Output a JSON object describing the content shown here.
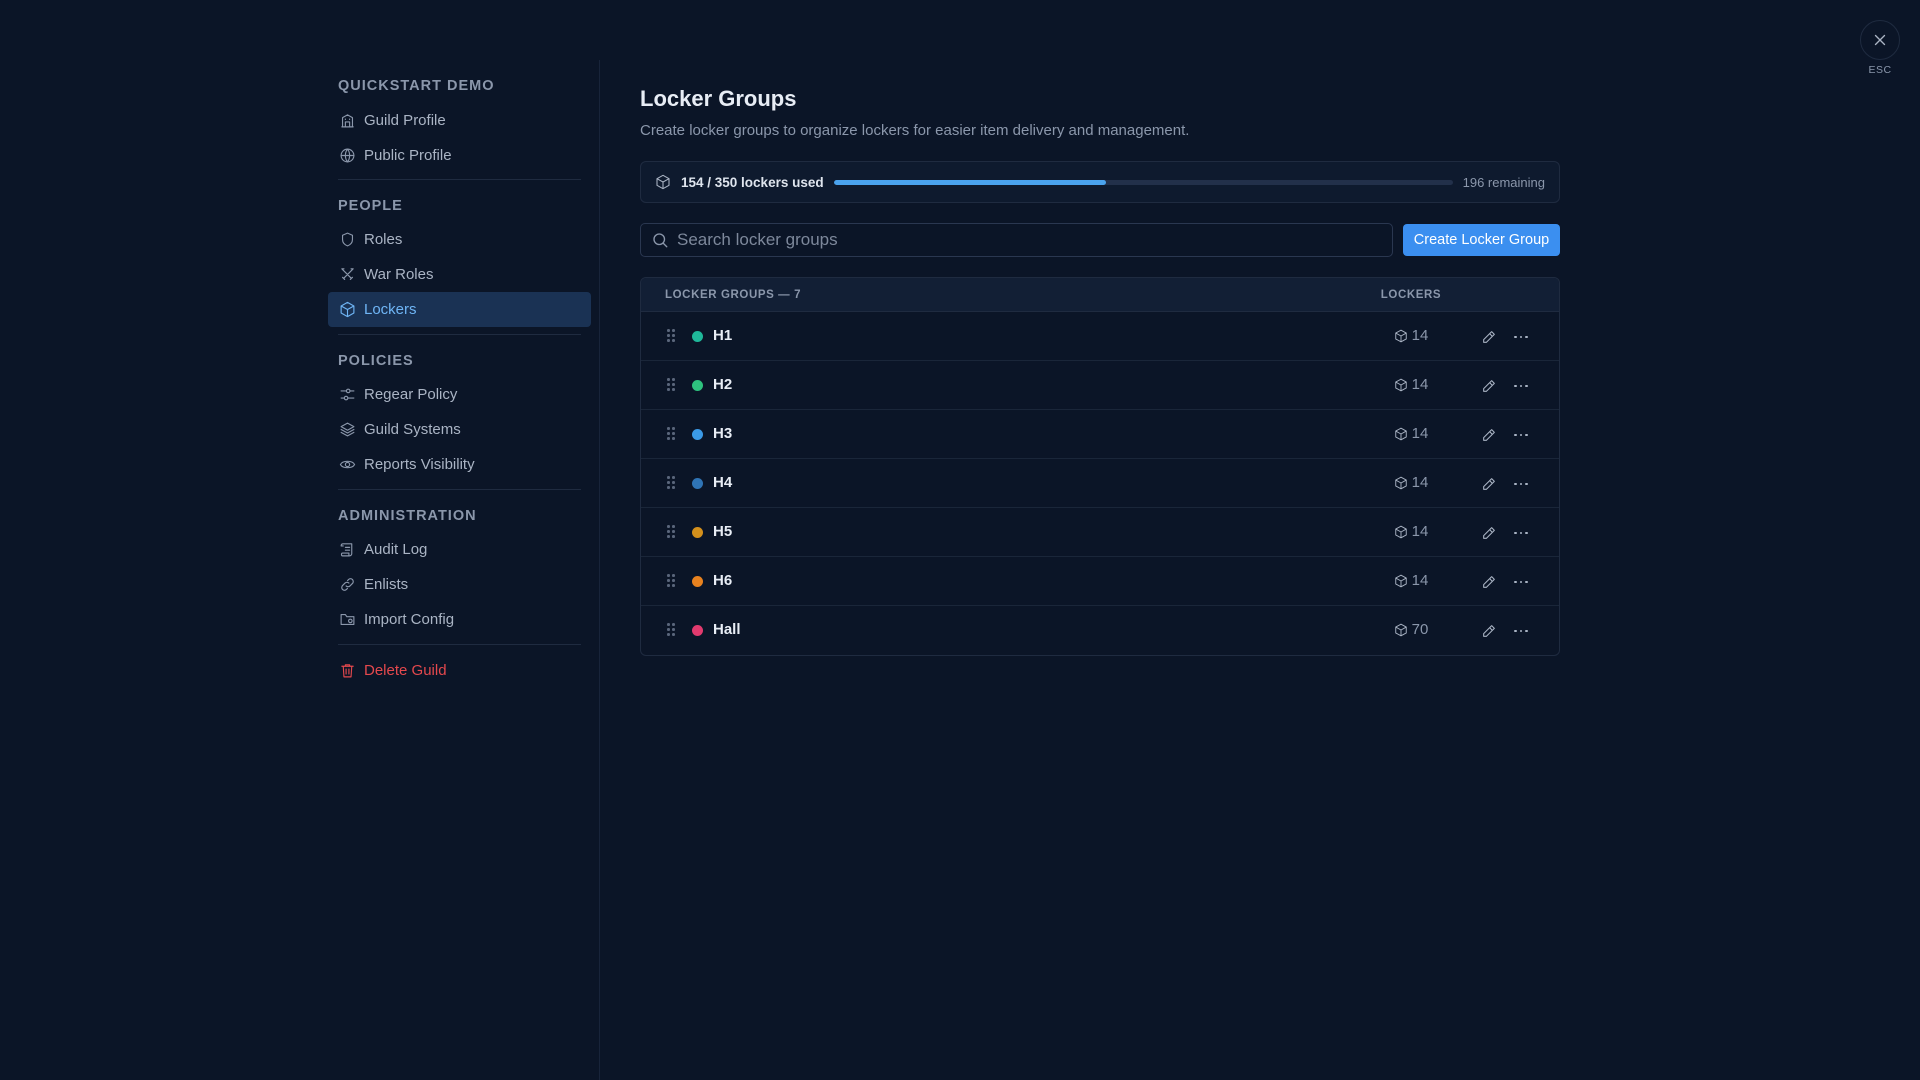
{
  "sidebar": {
    "sections": [
      {
        "title": "QUICKSTART DEMO",
        "items": [
          {
            "label": "Guild Profile",
            "icon": "building-icon"
          },
          {
            "label": "Public Profile",
            "icon": "globe-icon"
          }
        ]
      },
      {
        "title": "PEOPLE",
        "items": [
          {
            "label": "Roles",
            "icon": "shield-icon"
          },
          {
            "label": "War Roles",
            "icon": "crossed-swords-icon"
          },
          {
            "label": "Lockers",
            "icon": "box-icon",
            "active": true
          }
        ]
      },
      {
        "title": "POLICIES",
        "items": [
          {
            "label": "Regear Policy",
            "icon": "sliders-icon"
          },
          {
            "label": "Guild Systems",
            "icon": "layers-icon"
          },
          {
            "label": "Reports Visibility",
            "icon": "eye-icon"
          }
        ]
      },
      {
        "title": "ADMINISTRATION",
        "items": [
          {
            "label": "Audit Log",
            "icon": "scroll-icon"
          },
          {
            "label": "Enlists",
            "icon": "link-icon"
          },
          {
            "label": "Import Config",
            "icon": "folder-icon"
          }
        ]
      }
    ],
    "danger": {
      "label": "Delete Guild",
      "icon": "trash-icon"
    }
  },
  "close": {
    "esc_label": "ESC"
  },
  "header": {
    "title": "Locker Groups",
    "description": "Create locker groups to organize lockers for easier item delivery and management."
  },
  "usage": {
    "text": "154 / 350 lockers used",
    "used": 154,
    "total": 350,
    "remaining_text": "196 remaining"
  },
  "search": {
    "placeholder": "Search locker groups"
  },
  "create_button": "Create Locker Group",
  "table": {
    "header_name": "LOCKER GROUPS — 7",
    "header_lockers": "LOCKERS",
    "rows": [
      {
        "name": "H1",
        "color": "#1fb89a",
        "count": "14"
      },
      {
        "name": "H2",
        "color": "#2ec27e",
        "count": "14"
      },
      {
        "name": "H3",
        "color": "#3b9ae6",
        "count": "14"
      },
      {
        "name": "H4",
        "color": "#2f74b5",
        "count": "14"
      },
      {
        "name": "H5",
        "color": "#d4901c",
        "count": "14"
      },
      {
        "name": "H6",
        "color": "#e8821f",
        "count": "14"
      },
      {
        "name": "Hall",
        "color": "#e23a6e",
        "count": "70"
      }
    ]
  },
  "colors": {
    "background": "#0b1527",
    "accent": "#3b8ff0",
    "active_nav": "#6fb5f5",
    "danger": "#e5484d"
  }
}
